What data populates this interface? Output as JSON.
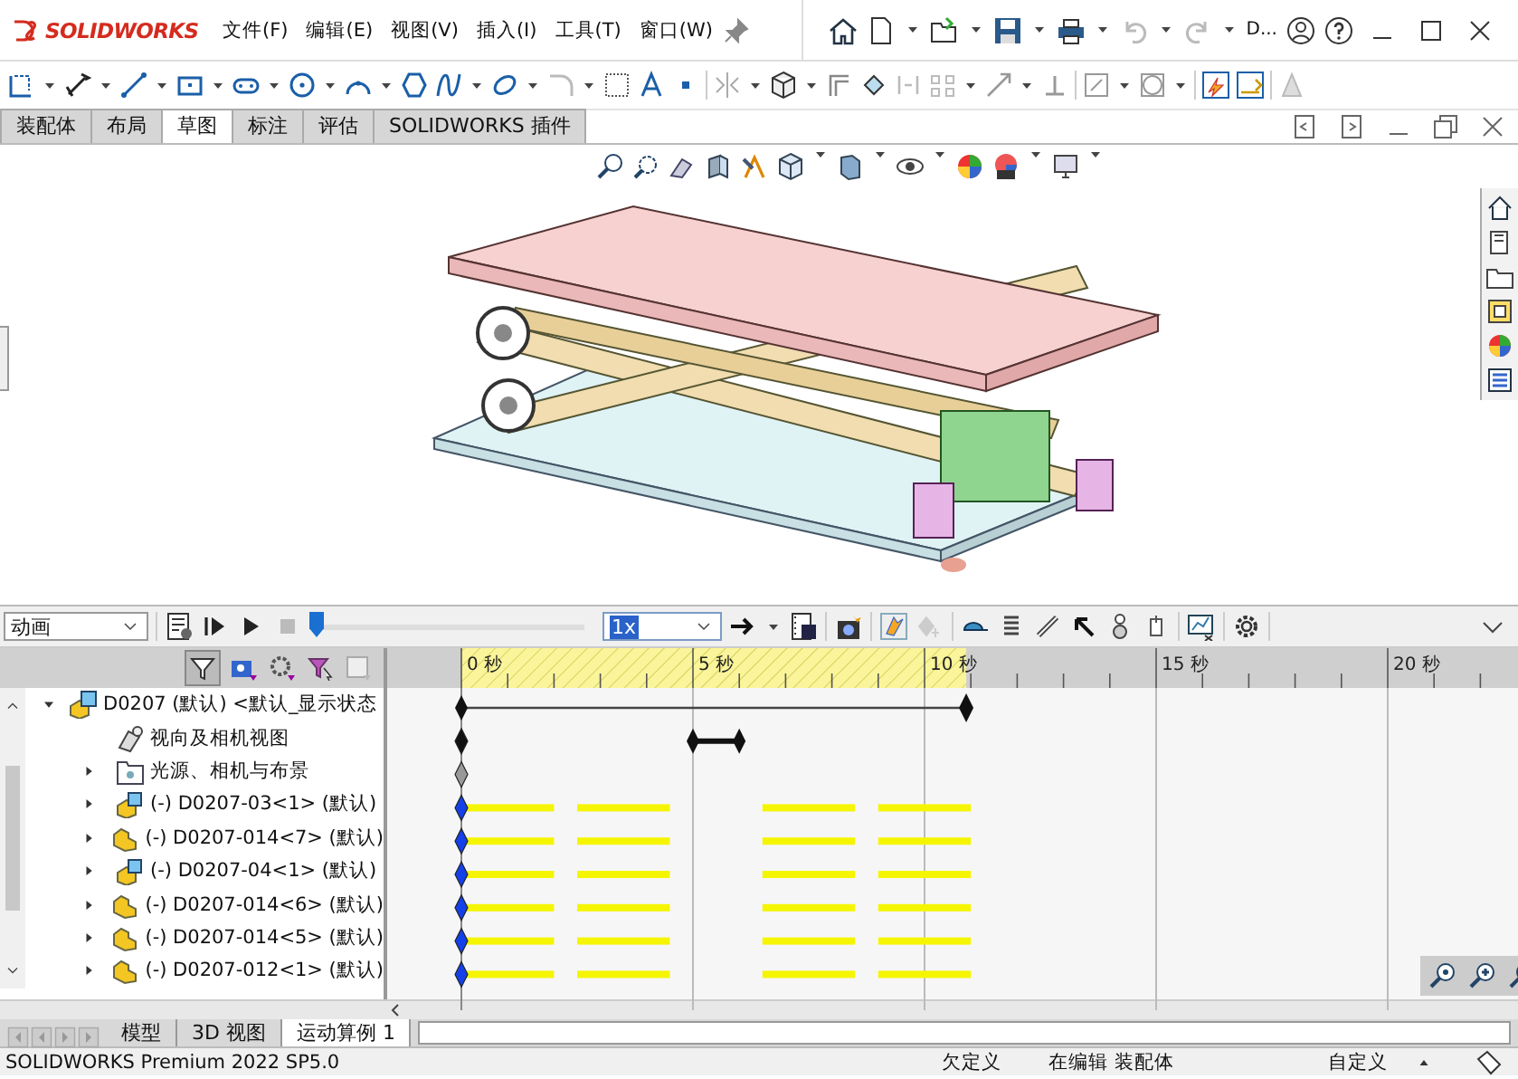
{
  "title_bar": {
    "brand": "SOLIDWORKS",
    "menus": [
      "文件(F)",
      "编辑(E)",
      "视图(V)",
      "插入(I)",
      "工具(T)",
      "窗口(W)"
    ],
    "document_label": "D..."
  },
  "ribbon_tabs": [
    {
      "label": "装配体",
      "selected": false
    },
    {
      "label": "布局",
      "selected": false
    },
    {
      "label": "草图",
      "selected": true
    },
    {
      "label": "标注",
      "selected": false
    },
    {
      "label": "评估",
      "selected": false
    },
    {
      "label": "SOLIDWORKS 插件",
      "selected": false
    }
  ],
  "motion_toolbar": {
    "study_type": "动画",
    "timeline_slider": {
      "level": 0
    },
    "speed": "1x"
  },
  "timeline": {
    "ticks": [
      "0 秒",
      "5 秒",
      "10 秒",
      "15 秒",
      "20 秒"
    ],
    "tracks": [
      {
        "kind": "duration"
      },
      {
        "kind": "key_range"
      },
      {
        "kind": "inactive"
      },
      {
        "kind": "component"
      },
      {
        "kind": "component"
      },
      {
        "kind": "component"
      },
      {
        "kind": "component"
      },
      {
        "kind": "component"
      },
      {
        "kind": "component"
      }
    ]
  },
  "tree": {
    "label": "D0207 (默认) <默认_显示状态",
    "kind": "assembly",
    "expanded": true,
    "children": [
      {
        "label": "视向及相机视图",
        "kind": "camera"
      },
      {
        "label": "光源、相机与布景",
        "kind": "lights",
        "expanded": false
      },
      {
        "label": "(-) D0207-03<1> (默认)",
        "kind": "subassembly",
        "expanded": false
      },
      {
        "label": "(-) D0207-014<7> (默认)",
        "kind": "part",
        "expanded": false
      },
      {
        "label": "(-) D0207-04<1> (默认)",
        "kind": "subassembly",
        "expanded": false
      },
      {
        "label": "(-) D0207-014<6> (默认)",
        "kind": "part",
        "expanded": false
      },
      {
        "label": "(-) D0207-014<5> (默认)",
        "kind": "part",
        "expanded": false
      },
      {
        "label": "(-) D0207-012<1> (默认)",
        "kind": "part",
        "expanded": false
      }
    ]
  },
  "bottom_tabs": [
    {
      "label": "模型",
      "selected": false
    },
    {
      "label": "3D 视图",
      "selected": false
    },
    {
      "label": "运动算例 1",
      "selected": true
    }
  ],
  "status_bar": {
    "product": "SOLIDWORKS Premium 2022 SP5.0",
    "definition": "欠定义",
    "mode": "在编辑 装配体",
    "units": "自定义"
  }
}
